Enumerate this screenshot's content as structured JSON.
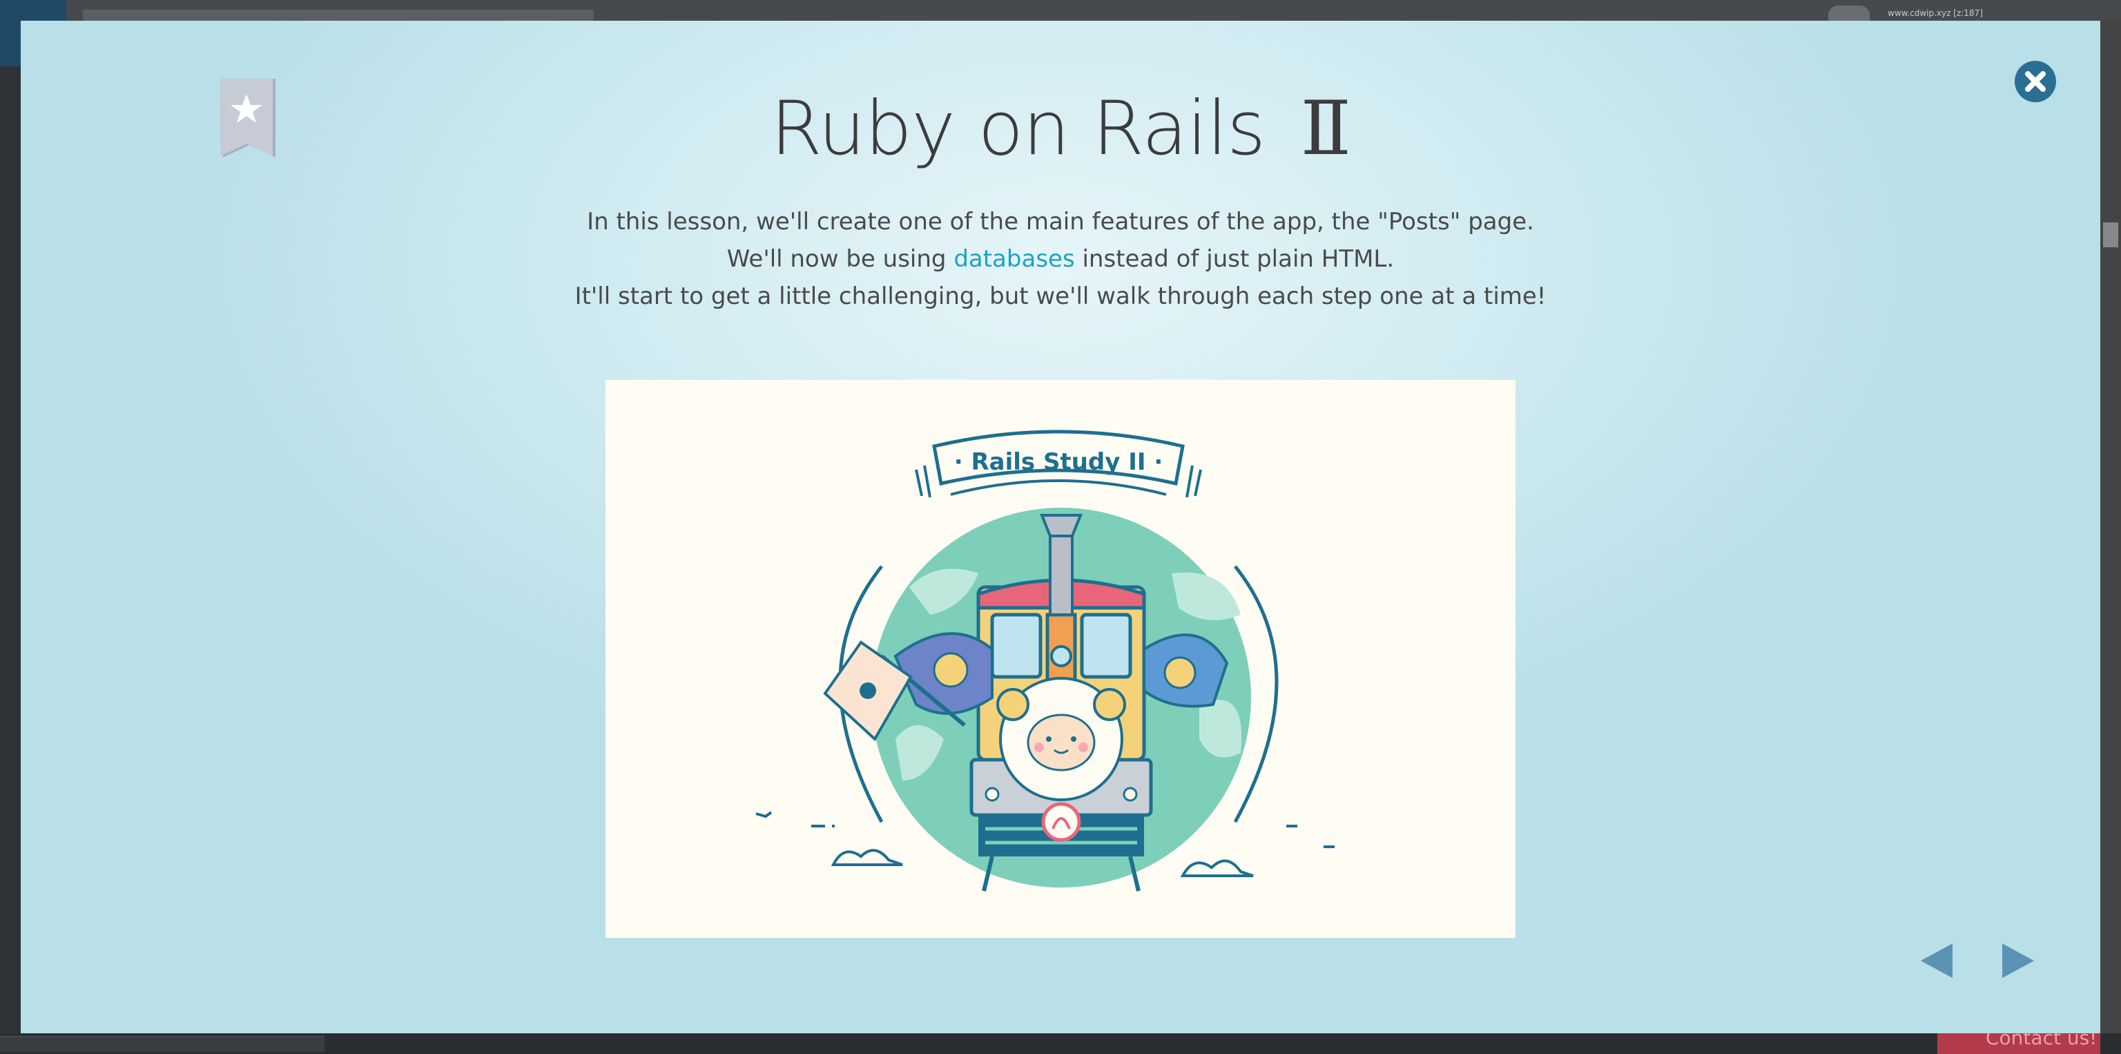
{
  "background": {
    "url_text": "www.cdwip.xyz [z:187]",
    "contact_label": "Contact us!"
  },
  "lesson": {
    "title": "Ruby on Rails",
    "title_numeral": "Ⅱ",
    "description": {
      "line1": "In this lesson, we'll create one of the main features of the app, the \"Posts\" page.",
      "line2_before": "We'll now be using ",
      "line2_link": "databases",
      "line2_after": " instead of just plain HTML.",
      "line3": "It'll start to get a little challenging, but we'll walk through each step one at a time!"
    },
    "illustration": {
      "banner_text": "· Rails Study II ·"
    }
  },
  "icons": {
    "bookmark": "bookmark-star-icon",
    "close": "close-circle-icon",
    "prev": "triangle-left-icon",
    "next": "triangle-right-icon"
  },
  "colors": {
    "accent_link": "#1aa3c7",
    "close_button": "#2a6e94",
    "nav_arrow": "#5b93b5",
    "bookmark": "#c3c8d4"
  }
}
